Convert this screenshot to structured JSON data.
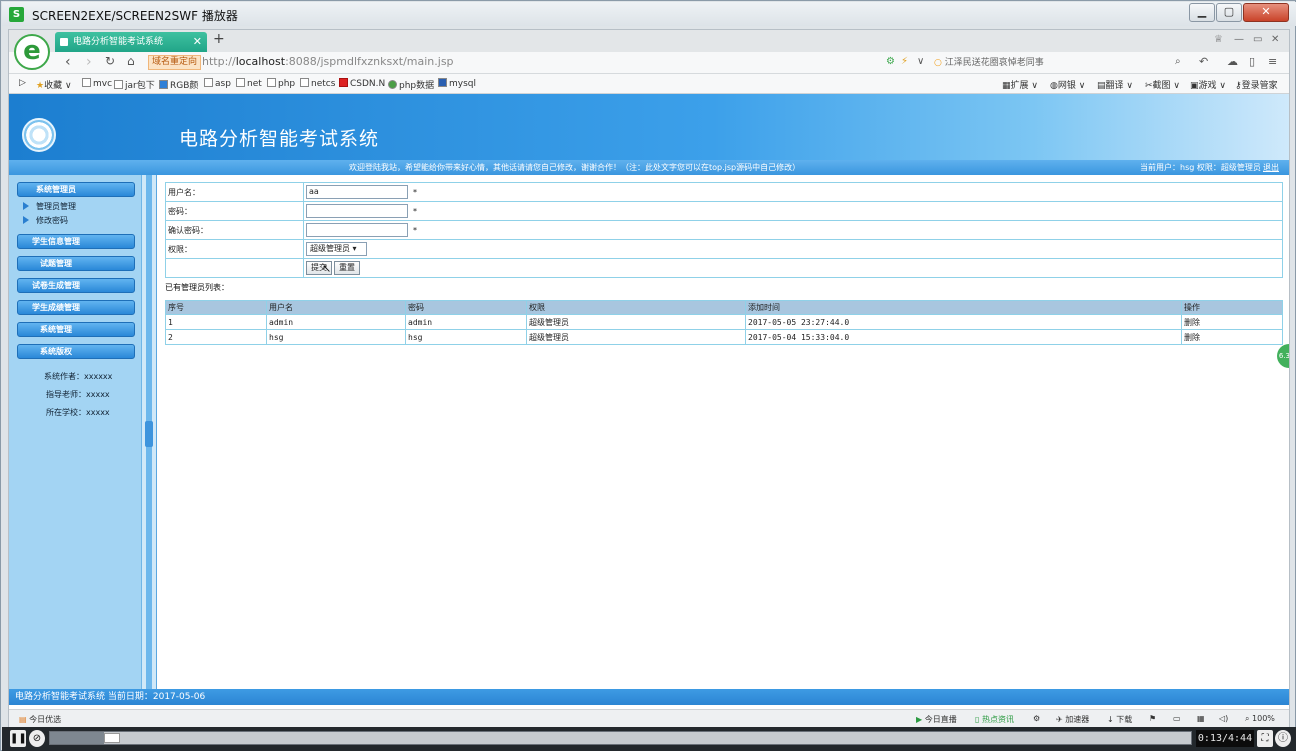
{
  "window": {
    "title": "SCREEN2EXE/SCREEN2SWF 播放器",
    "min": "▁",
    "max": "▢",
    "close": "✕"
  },
  "browser": {
    "tab_title": "电路分析智能考试系统",
    "tab_close": "✕",
    "new_tab": "+",
    "redirect_badge": "域名重定向",
    "url_prefix": "http://",
    "url_host": "localhost",
    "url_rest": ":8088/jspmdlfxznksxt/main.jsp",
    "search_text": "江泽民送花圈哀悼老同事",
    "bookmarks": [
      "收藏",
      "mvc",
      "jar包下",
      "RGB颜",
      "asp",
      "net",
      "php",
      "netcs",
      "CSDN.N",
      "php数据",
      "mysql"
    ],
    "right_tools": [
      "扩展",
      "网银",
      "翻译",
      "截图",
      "游戏",
      "登录管家"
    ],
    "status_left": "今日优选",
    "status_right": [
      "今日直播",
      "热点资讯",
      "加速器",
      "下载",
      "100%"
    ]
  },
  "page": {
    "system_title": "电路分析智能考试系统",
    "welcome": "欢迎登陆我站，希望能给你带来好心情，其他话请请您自己修改，谢谢合作！（注：此处文字您可以在top.jsp源码中自己修改）",
    "user_info": "当前用户：hsg 权限：超级管理员",
    "logout": "退出",
    "sidebar": {
      "group1": "系统管理员",
      "group1_items": [
        "管理员管理",
        "修改密码"
      ],
      "groups": [
        "学生信息管理",
        "试题管理",
        "试卷生成管理",
        "学生成绩管理",
        "系统管理",
        "系统版权"
      ],
      "info": [
        "系统作者：xxxxxx",
        "指导老师：xxxxx",
        "所在学校：xxxxx"
      ]
    },
    "form": {
      "username_label": "用户名：",
      "username_value": "aa",
      "password_label": "密码：",
      "confirm_label": "确认密码：",
      "role_label": "权限：",
      "role_value": "超级管理员",
      "required": "*",
      "submit": "提交",
      "reset": "重置"
    },
    "list_title": "已有管理员列表：",
    "table": {
      "headers": [
        "序号",
        "用户名",
        "密码",
        "权限",
        "添加时间",
        "操作"
      ],
      "rows": [
        [
          "1",
          "admin",
          "admin",
          "超级管理员",
          "2017-05-05 23:27:44.0",
          "删除"
        ],
        [
          "2",
          "hsg",
          "hsg",
          "超级管理员",
          "2017-05-04 15:33:04.0",
          "删除"
        ]
      ]
    },
    "footer": "电路分析智能考试系统 当前日期：2017-05-06",
    "side_badge": "6.3"
  },
  "player": {
    "time": "0:13/4:44",
    "progress": 0.047
  }
}
